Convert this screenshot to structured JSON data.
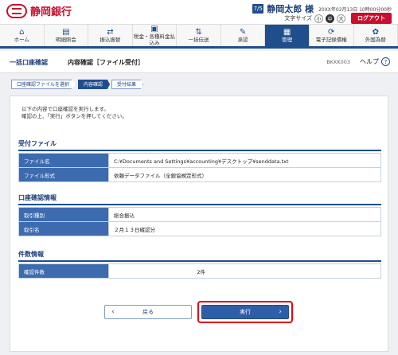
{
  "header": {
    "bank_name": "静岡銀行",
    "user_badge": "7/5",
    "user_name": "静岡太郎 様",
    "datetime": "20XX年02月13日 10時00分00秒",
    "font_size_label": "文字サイズ",
    "font_sizes": [
      "小",
      "中",
      "大"
    ],
    "logout": "ログアウト"
  },
  "nav": [
    {
      "icon": "home-icon",
      "label": "ホーム"
    },
    {
      "icon": "list-icon",
      "label": "明細照会"
    },
    {
      "icon": "transfer-icon",
      "label": "振込振替"
    },
    {
      "icon": "tax-icon",
      "label": "税金・各種料金払込み"
    },
    {
      "icon": "bulk-icon",
      "label": "一括伝送"
    },
    {
      "icon": "approve-icon",
      "label": "承認"
    },
    {
      "icon": "admin-icon",
      "label": "管理"
    },
    {
      "icon": "record-icon",
      "label": "電子記録債権"
    },
    {
      "icon": "fx-icon",
      "label": "外国為替"
    }
  ],
  "title": {
    "main": "一括口座確認",
    "sub": "内容確認［ファイル受付］",
    "code": "BKKK003",
    "help": "ヘルプ"
  },
  "steps": [
    "口座確認ファイルを選択",
    "内容確認",
    "受付結果"
  ],
  "intro": [
    "以下の内容で口座確認を実行します。",
    "確認の上、「実行」ボタンを押してください。"
  ],
  "sections": {
    "file": "受付ファイル",
    "info": "口座確認情報",
    "count": "件数情報"
  },
  "file_rows": [
    {
      "label": "ファイル名",
      "value": "C:¥Documents and Settings¥accounting¥デスクトップ¥senddata.txt"
    },
    {
      "label": "ファイル形式",
      "value": "依頼データファイル（全銀協規定形式）"
    }
  ],
  "info_rows": [
    {
      "label": "取引種別",
      "value": "総合振込"
    },
    {
      "label": "取引名",
      "value": "２月１３日確認分"
    }
  ],
  "count_rows": [
    {
      "label": "確認件数",
      "value": "2件"
    }
  ],
  "buttons": {
    "back": "戻る",
    "execute": "実行"
  },
  "colors": {
    "brand": "#c8102e",
    "navy": "#1f4e8c",
    "highlight": "#e60012"
  }
}
